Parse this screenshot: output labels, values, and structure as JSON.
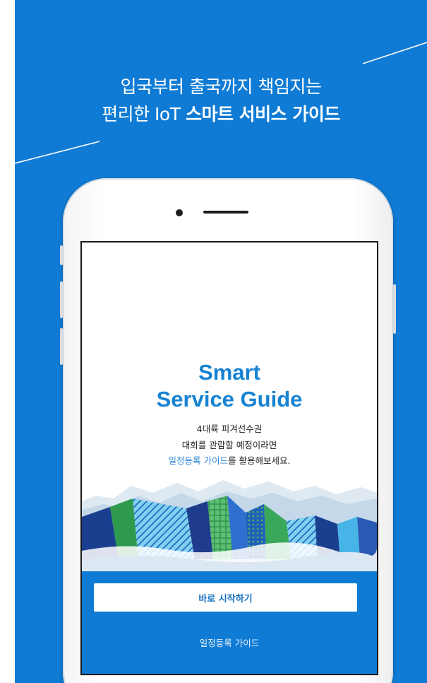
{
  "promo": {
    "headline_line1": "입국부터 출국까지 책임지는",
    "headline_line2_prefix": "편리한 IoT",
    "headline_line2_bold": "스마트 서비스 가이드",
    "background_color": "#0f7bd4"
  },
  "screen": {
    "title_line1": "Smart",
    "title_line2": "Service Guide",
    "subtitle_line1": "4대륙 피겨선수권",
    "subtitle_line2": "대회를 관람할 예정이라면",
    "subtitle_line3_link": "일정등록 가이드",
    "subtitle_line3_rest": "를 활용해보세요.",
    "start_button_label": "바로 시작하기",
    "guide_link_label": "일정등록 가이드",
    "accent_color": "#1682d2"
  }
}
